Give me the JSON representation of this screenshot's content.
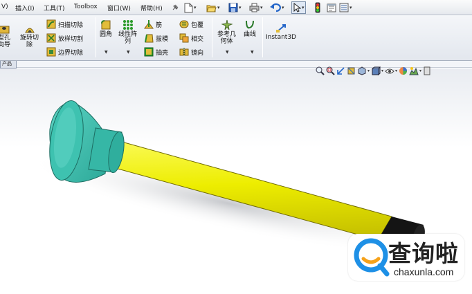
{
  "menu": {
    "items": [
      "V)",
      "插入(I)",
      "工具(T)",
      "Toolbox",
      "窗口(W)",
      "帮助(H)"
    ]
  },
  "ribbon": {
    "hole_wizard": "型孔\n向导",
    "revolve_cut": "旋转切\n除",
    "sweep_cut": "扫描切除",
    "loft_cut": "放样切割",
    "boundary_cut": "边界切除",
    "fillet": "圆角",
    "linear_pattern": "线性阵\n列",
    "rib": "筋",
    "draft": "拔模",
    "shell": "抽壳",
    "wrap": "包覆",
    "intersect": "相交",
    "mirror": "镜向",
    "ref_geometry": "参考几\n何体",
    "curves": "曲线",
    "instant3d": "Instant3D"
  },
  "tab": {
    "product": "产品"
  },
  "colors": {
    "cone": "#3ec2b0",
    "shaft": "#f0f000",
    "tip": "#111111",
    "watermark_blue": "#1e90e6",
    "watermark_orange": "#f6a21a"
  },
  "watermark": {
    "title": "查询啦",
    "url": "chaxunla.com"
  }
}
